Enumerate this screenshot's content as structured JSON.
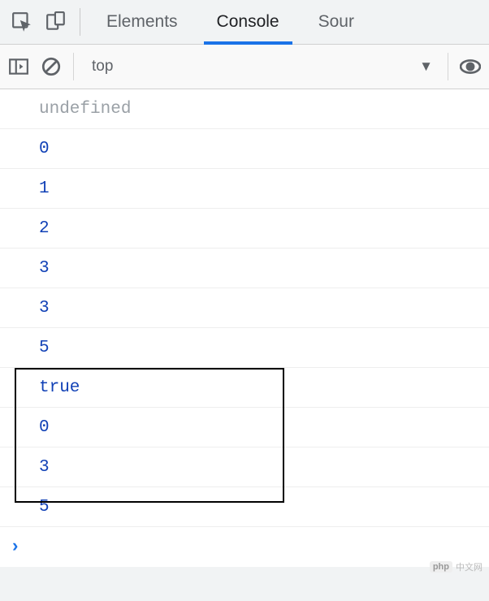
{
  "tabs": {
    "elements": "Elements",
    "console": "Console",
    "sources_partial": "Sour"
  },
  "filter": {
    "context": "top"
  },
  "console": {
    "lines": [
      {
        "kind": "undef",
        "text": "undefined"
      },
      {
        "kind": "num",
        "text": "0"
      },
      {
        "kind": "num",
        "text": "1"
      },
      {
        "kind": "num",
        "text": "2"
      },
      {
        "kind": "num",
        "text": "3"
      },
      {
        "kind": "num",
        "text": "3"
      },
      {
        "kind": "num",
        "text": "5"
      },
      {
        "kind": "bool",
        "text": "true"
      },
      {
        "kind": "num",
        "text": "0"
      },
      {
        "kind": "num",
        "text": "3"
      },
      {
        "kind": "num",
        "text": "5"
      }
    ],
    "boxed_start_index": 7,
    "boxed_end_index": 10
  },
  "watermark": {
    "brand": "php",
    "label": "中文网"
  }
}
